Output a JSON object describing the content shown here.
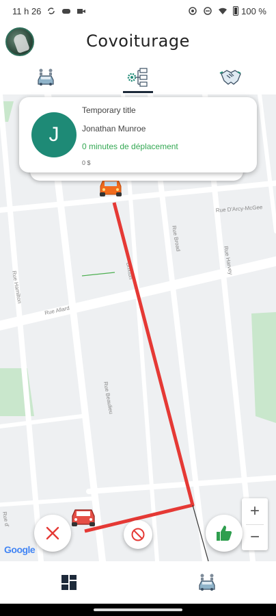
{
  "status_bar": {
    "time": "11 h 26",
    "battery": "100 %",
    "icons": [
      "sync-icon",
      "game-icon",
      "video-icon",
      "cast-icon",
      "dnd-icon",
      "wifi-icon",
      "battery-icon"
    ]
  },
  "header": {
    "title": "Covoiturage"
  },
  "tabs": [
    {
      "icon": "car-with-passengers-icon",
      "active": false
    },
    {
      "icon": "route-settings-icon",
      "active": true
    },
    {
      "icon": "handshake-icon",
      "active": false
    }
  ],
  "ride_card": {
    "title": "Temporary title",
    "driver_initial": "J",
    "driver_name": "Jonathan Munroe",
    "travel_time": "0 minutes de déplacement",
    "price": "0 $"
  },
  "map": {
    "streets": {
      "darcy_mcgee": "Rue D'Arcy-McGee",
      "brixton": "Brixton",
      "broad": "Rue Broad",
      "harvey": "Rue Harvey",
      "hamilton": "Rue Hamilton",
      "allard": "Rue Allard",
      "beaulieu": "Rue Beaulieu",
      "rue_d": "Rue d'",
      "rue_d_suffix": "d'"
    },
    "route_color": "#e53935",
    "zoom_in_label": "+",
    "zoom_out_label": "−",
    "google_logo": "Google"
  },
  "actions": {
    "reject": "close-icon",
    "cancel": "block-icon",
    "accept": "thumbs-up-icon"
  },
  "bottom_nav": [
    {
      "icon": "dashboard-icon"
    },
    {
      "icon": "car-icon"
    }
  ],
  "colors": {
    "accent": "#1d2a3a",
    "avatar_teal": "#1e8a76",
    "success_green": "#34a853",
    "reject_red": "#e53935",
    "accept_green": "#2e9e4e"
  }
}
